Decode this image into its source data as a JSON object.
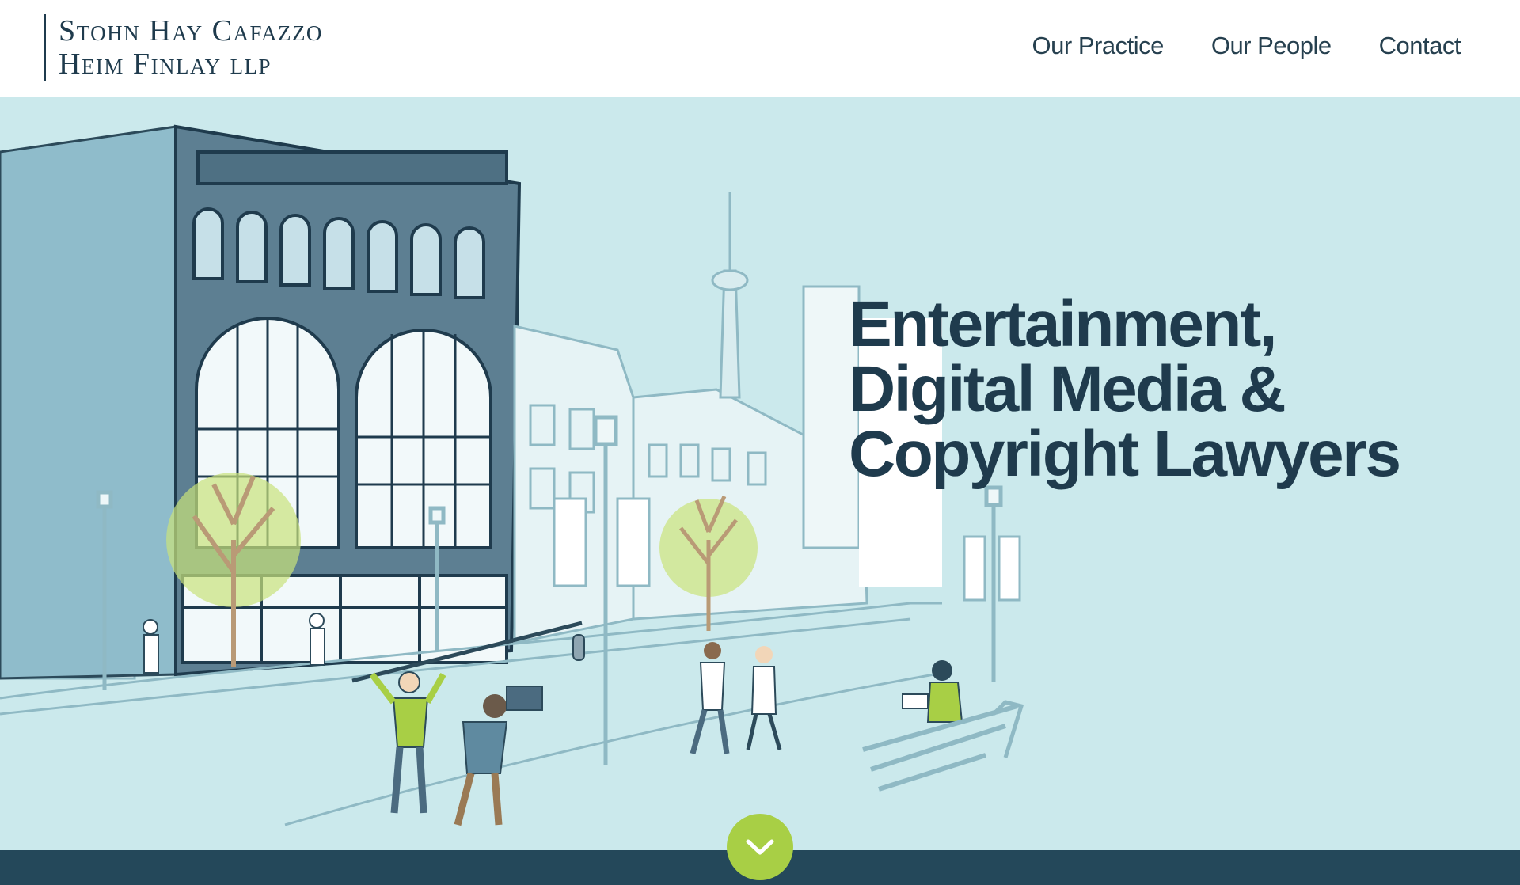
{
  "header": {
    "logo": {
      "line1": "Stohn Hay Cafazzo",
      "line2": "Heim Finlay llp"
    },
    "nav": [
      {
        "label": "Our Practice"
      },
      {
        "label": "Our People"
      },
      {
        "label": "Contact"
      }
    ]
  },
  "hero": {
    "headline": [
      "Entertainment,",
      "Digital Media &",
      "Copyright Lawyers"
    ],
    "illustration_subject": "toronto-street-film-crew-illustration"
  },
  "scroll_button": {
    "icon": "chevron-down-icon"
  },
  "colors": {
    "navy": "#1f3b4d",
    "hero_bg": "#cbe9ec",
    "accent_green": "#a8cf45",
    "footer_bar": "#24485a"
  }
}
